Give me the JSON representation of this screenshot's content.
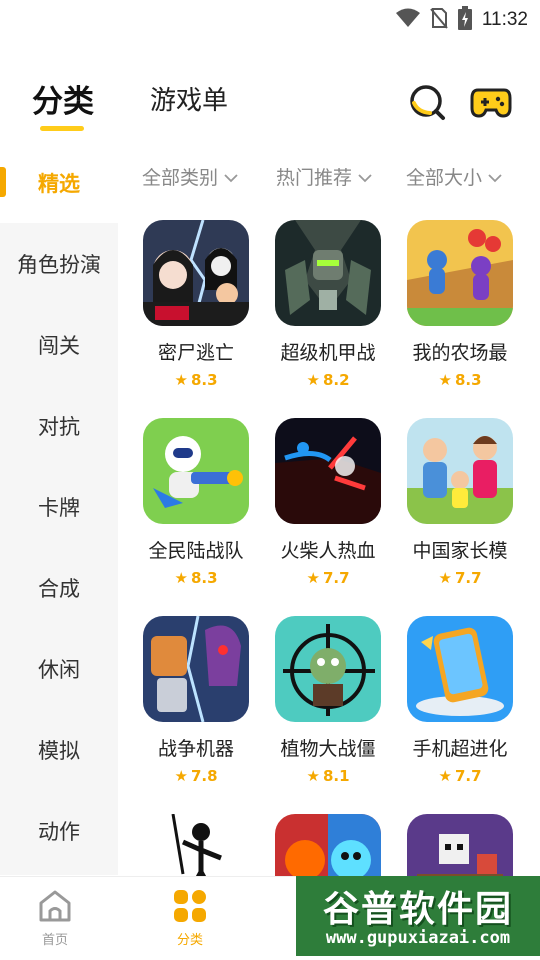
{
  "status_bar": {
    "time": "11:32",
    "icons": [
      "wifi-icon",
      "no-sim-icon",
      "battery-charging-icon"
    ]
  },
  "header": {
    "tabs": [
      {
        "label": "分类",
        "active": true
      },
      {
        "label": "游戏单",
        "active": false
      }
    ],
    "search_icon": "search-icon",
    "gamepad_icon": "gamepad-icon"
  },
  "sidebar": {
    "items": [
      {
        "label": "精选",
        "active": true
      },
      {
        "label": "角色扮演"
      },
      {
        "label": "闯关"
      },
      {
        "label": "对抗"
      },
      {
        "label": "卡牌"
      },
      {
        "label": "合成"
      },
      {
        "label": "休闲"
      },
      {
        "label": "模拟"
      },
      {
        "label": "动作"
      }
    ]
  },
  "filters": [
    {
      "label": "全部类别"
    },
    {
      "label": "热门推荐"
    },
    {
      "label": "全部大小"
    }
  ],
  "games": [
    {
      "name": "密尸逃亡",
      "rating": "8.3"
    },
    {
      "name": "超级机甲战",
      "rating": "8.2"
    },
    {
      "name": "我的农场最",
      "rating": "8.3"
    },
    {
      "name": "全民陆战队",
      "rating": "8.3"
    },
    {
      "name": "火柴人热血",
      "rating": "7.7"
    },
    {
      "name": "中国家长模",
      "rating": "7.7"
    },
    {
      "name": "战争机器",
      "rating": "7.8"
    },
    {
      "name": "植物大战僵",
      "rating": "8.1"
    },
    {
      "name": "手机超进化",
      "rating": "7.7"
    },
    {
      "name": "",
      "rating": ""
    },
    {
      "name": "",
      "rating": ""
    },
    {
      "name": "",
      "rating": ""
    }
  ],
  "bottom_nav": [
    {
      "label": "首页",
      "active": false
    },
    {
      "label": "分类",
      "active": true
    }
  ],
  "watermark": {
    "title": "谷普软件园",
    "url": "www.gupuxiazai.com"
  },
  "colors": {
    "accent": "#F5A800",
    "tab_underline": "#FFCC1A",
    "sidebar_bg": "#f6f6f6"
  }
}
